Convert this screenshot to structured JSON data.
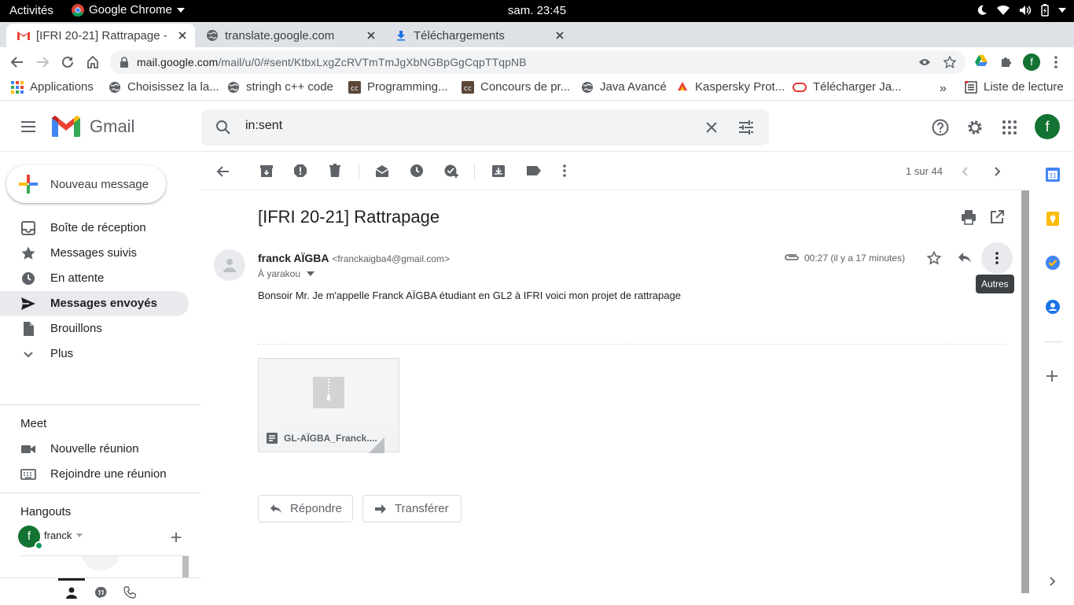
{
  "os": {
    "activities": "Activités",
    "app_name": "Google Chrome",
    "clock": "sam. 23:45"
  },
  "tabs": [
    {
      "title": "[IFRI 20-21] Rattrapage -",
      "active": true
    },
    {
      "title": "translate.google.com",
      "active": false
    },
    {
      "title": "Téléchargements",
      "active": false
    }
  ],
  "address": {
    "domain": "mail.google.com",
    "path": "/mail/u/0/#sent/KtbxLxgZcRVTmTmJgXbNGBpGgCqpTTqpNB",
    "profile_initial": "f"
  },
  "bookmarks": [
    {
      "label": "Applications",
      "icon": "apps-grid-icon"
    },
    {
      "label": "Choisissez la la...",
      "icon": "globe-icon"
    },
    {
      "label": "stringh c++ code",
      "icon": "globe-icon"
    },
    {
      "label": "Programming...",
      "icon": "cc-icon"
    },
    {
      "label": "Concours de pr...",
      "icon": "cc-icon"
    },
    {
      "label": "Java Avancé",
      "icon": "globe-icon"
    },
    {
      "label": "Kaspersky Prot...",
      "icon": "kaspersky-icon"
    },
    {
      "label": "Télécharger Ja...",
      "icon": "oracle-icon"
    }
  ],
  "reading_list": "Liste de lecture",
  "gmail": {
    "logo_text": "Gmail",
    "search_value": "in:sent",
    "avatar_initial": "f",
    "compose": "Nouveau message",
    "nav": [
      {
        "label": "Boîte de réception",
        "icon": "inbox-icon",
        "selected": false
      },
      {
        "label": "Messages suivis",
        "icon": "star-icon",
        "selected": false
      },
      {
        "label": "En attente",
        "icon": "clock-icon",
        "selected": false
      },
      {
        "label": "Messages envoyés",
        "icon": "send-icon",
        "selected": true
      },
      {
        "label": "Brouillons",
        "icon": "draft-icon",
        "selected": false
      },
      {
        "label": "Plus",
        "icon": "chevron-down-icon",
        "selected": false
      }
    ],
    "meet": {
      "title": "Meet",
      "new_meeting": "Nouvelle réunion",
      "join_meeting": "Rejoindre une réunion"
    },
    "hangouts": {
      "title": "Hangouts",
      "user": "franck",
      "user_initial": "f"
    },
    "toolbar": {
      "pagination": "1 sur 44"
    },
    "message": {
      "subject": "[IFRI 20-21] Rattrapage",
      "sender_name": "franck AÏGBA",
      "sender_email": "<franckaigba4@gmail.com>",
      "recipient": "À yarakou",
      "time": "00:27 (il y a 17 minutes)",
      "tooltip": "Autres",
      "body": "Bonsoir Mr. Je m'appelle Franck AÏGBA étudiant en GL2 à IFRI voici mon projet de rattrapage",
      "attachment_name": "GL-AÏGBA_Franck....",
      "reply": "Répondre",
      "forward": "Transférer"
    }
  }
}
